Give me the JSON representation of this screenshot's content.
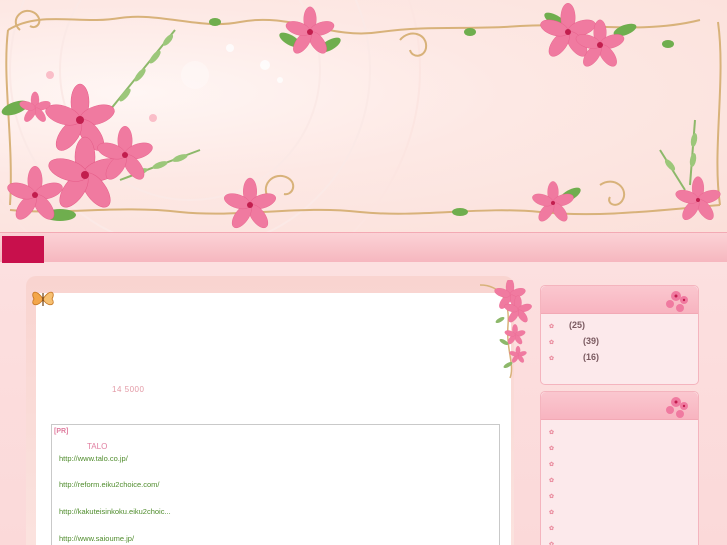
{
  "main": {
    "date": "14 5000"
  },
  "ad": {
    "pr_label": "[PR]",
    "title": "TALO",
    "links": [
      "http://www.talo.co.jp/",
      "http://reform.eiku2choice.com/",
      "http://kakuteisinkoku.eiku2choic...",
      "http://www.saioume.jp/"
    ]
  },
  "sidebar": {
    "categories": [
      {
        "count": "(25)"
      },
      {
        "count": "(39)"
      },
      {
        "count": "(16)"
      }
    ],
    "recent_items": 8
  },
  "colors": {
    "accent": "#c8104c",
    "link": "#4f8c2c",
    "pink_text": "#e07ea0"
  }
}
